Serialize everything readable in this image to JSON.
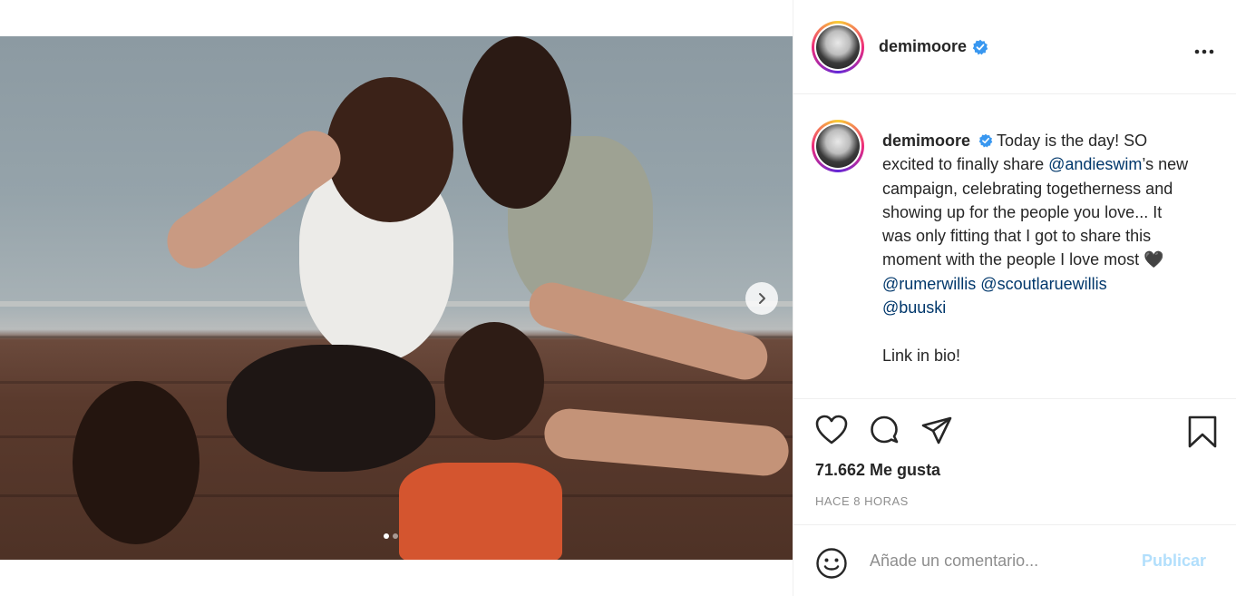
{
  "post": {
    "username": "demimoore",
    "verified": true,
    "more_icon": "more-horizontal-icon",
    "caption": {
      "username": "demimoore",
      "text_1": "Today is the day! SO excited to finally share ",
      "mention_1": "@andieswim",
      "text_2": "’s new campaign, celebrating togetherness and showing up for the people you love... It was only fitting that I got to share this moment with the people I love most ",
      "heart": "🖤",
      "mention_2": "@rumerwillis",
      "mention_3": "@scoutlaruewillis",
      "mention_4": "@buuski",
      "link_text": "Link in bio!"
    },
    "likes": "71.662 Me gusta",
    "time": "HACE 8 HORAS",
    "comment_placeholder": "Añade un comentario...",
    "publish_label": "Publicar",
    "carousel": {
      "total": 2,
      "active": 1
    }
  },
  "colors": {
    "verified": "#3897f0",
    "mention": "#00376b",
    "publish_disabled": "#b2dffc"
  }
}
